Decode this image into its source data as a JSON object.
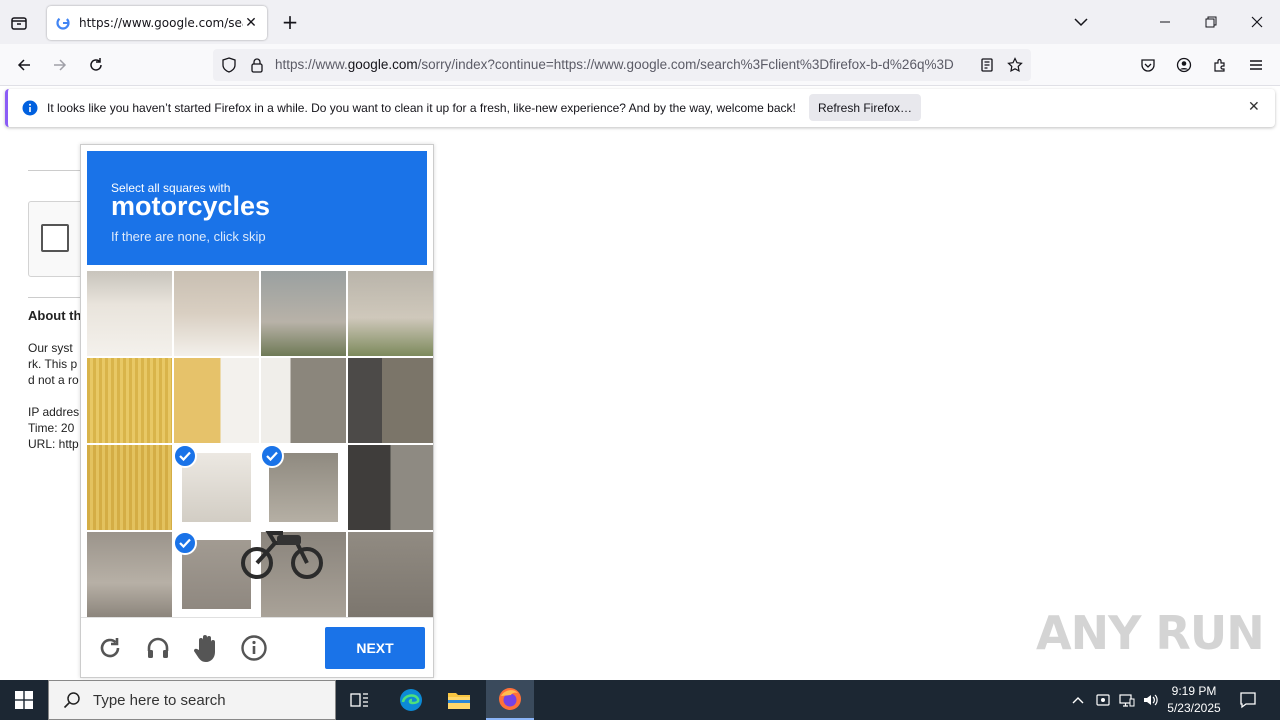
{
  "browser": {
    "tab_title": "https://www.google.com/search",
    "tab_close": "✕",
    "new_tab": "+",
    "url_host_prefix": "https://www.",
    "url_host": "google.com",
    "url_rest": "/sorry/index?continue=https://www.google.com/search%3Fclient%3Dfirefox-b-d%26q%3D"
  },
  "notification": {
    "message": "It looks like you haven’t started Firefox in a while. Do you want to clean it up for a fresh, like-new experience? And by the way, welcome back!",
    "button": "Refresh Firefox…",
    "close": "✕"
  },
  "page": {
    "about_heading": "About th",
    "line1": "Our syst",
    "line2": "rk. This p",
    "line3": "d not a ro",
    "ip": "IP addres",
    "time": "Time: 20",
    "url": "URL: http"
  },
  "captcha": {
    "instruction": "Select all squares with",
    "target": "motorcycles",
    "hint": "If there are none, click skip",
    "next_label": "NEXT",
    "tiles": [
      {
        "row": 0,
        "col": 0,
        "selected": false
      },
      {
        "row": 0,
        "col": 1,
        "selected": false
      },
      {
        "row": 0,
        "col": 2,
        "selected": false
      },
      {
        "row": 0,
        "col": 3,
        "selected": false
      },
      {
        "row": 1,
        "col": 0,
        "selected": false
      },
      {
        "row": 1,
        "col": 1,
        "selected": false
      },
      {
        "row": 1,
        "col": 2,
        "selected": false
      },
      {
        "row": 1,
        "col": 3,
        "selected": false
      },
      {
        "row": 2,
        "col": 0,
        "selected": false
      },
      {
        "row": 2,
        "col": 1,
        "selected": true
      },
      {
        "row": 2,
        "col": 2,
        "selected": true
      },
      {
        "row": 2,
        "col": 3,
        "selected": false
      },
      {
        "row": 3,
        "col": 0,
        "selected": false
      },
      {
        "row": 3,
        "col": 1,
        "selected": true
      },
      {
        "row": 3,
        "col": 2,
        "selected": false
      },
      {
        "row": 3,
        "col": 3,
        "selected": false
      }
    ],
    "icons": [
      "reload-icon",
      "audio-icon",
      "hand-icon",
      "info-icon"
    ]
  },
  "watermark": "ANY RUN",
  "taskbar": {
    "search_placeholder": "Type here to search",
    "time": "9:19 PM",
    "date": "5/23/2025"
  },
  "colors": {
    "accent": "#1a73e8",
    "taskbar": "#1c2733"
  }
}
